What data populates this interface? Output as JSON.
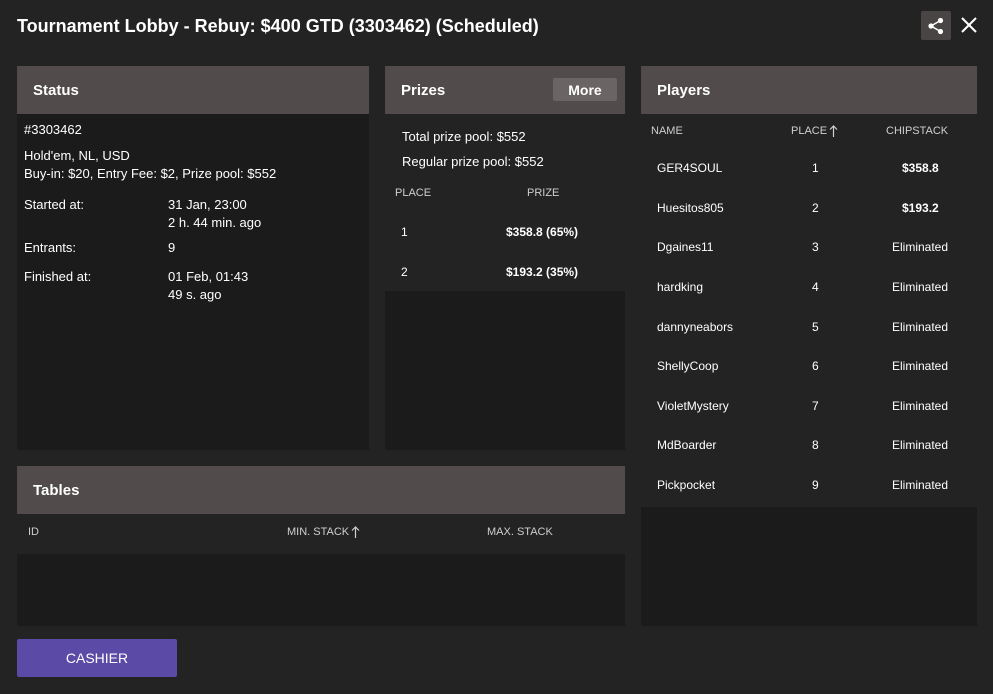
{
  "window": {
    "title": "Tournament Lobby - Rebuy: $400 GTD (3303462) (Scheduled)",
    "share_icon": "share-icon",
    "close_icon": "close-icon"
  },
  "status": {
    "header": "Status",
    "id": "#3303462",
    "game": "Hold'em, NL, USD",
    "buyin": "Buy-in: $20, Entry Fee: $2, Prize pool: $552",
    "started_label": "Started at:",
    "started_value": "31 Jan, 23:00",
    "started_ago": "2 h. 44 min. ago",
    "entrants_label": "Entrants:",
    "entrants_value": "9",
    "finished_label": "Finished at:",
    "finished_value": "01 Feb, 01:43",
    "finished_ago": "49 s. ago"
  },
  "prizes": {
    "header": "Prizes",
    "more_label": "More",
    "total_label": "Total prize pool:",
    "total_value": "$552",
    "regular_label": "Regular prize pool:",
    "regular_value": "$552",
    "columns": {
      "place": "PLACE",
      "prize": "PRIZE"
    },
    "rows": [
      {
        "place": "1",
        "prize": "$358.8 (65%)"
      },
      {
        "place": "2",
        "prize": "$193.2 (35%)"
      }
    ]
  },
  "players": {
    "header": "Players",
    "columns": {
      "name": "NAME",
      "place": "PLACE",
      "chipstack": "CHIPSTACK"
    },
    "sort_icon": "arrow-up-icon",
    "rows": [
      {
        "name": "GER4SOUL",
        "place": "1",
        "chipstack": "$358.8"
      },
      {
        "name": "Huesitos805",
        "place": "2",
        "chipstack": "$193.2"
      },
      {
        "name": "Dgaines11",
        "place": "3",
        "chipstack": "Eliminated"
      },
      {
        "name": "hardking",
        "place": "4",
        "chipstack": "Eliminated"
      },
      {
        "name": "dannyneabors",
        "place": "5",
        "chipstack": "Eliminated"
      },
      {
        "name": "ShellyCoop",
        "place": "6",
        "chipstack": "Eliminated"
      },
      {
        "name": "VioletMystery",
        "place": "7",
        "chipstack": "Eliminated"
      },
      {
        "name": "MdBoarder",
        "place": "8",
        "chipstack": "Eliminated"
      },
      {
        "name": "Pickpocket",
        "place": "9",
        "chipstack": "Eliminated"
      }
    ]
  },
  "tables": {
    "header": "Tables",
    "columns": {
      "id": "ID",
      "min_stack": "MIN. STACK",
      "max_stack": "MAX. STACK"
    }
  },
  "footer": {
    "cashier_label": "CASHIER"
  },
  "colors": {
    "background": "#232323",
    "panel_header": "#514b4b",
    "cashier_button": "#5b4aa6"
  }
}
